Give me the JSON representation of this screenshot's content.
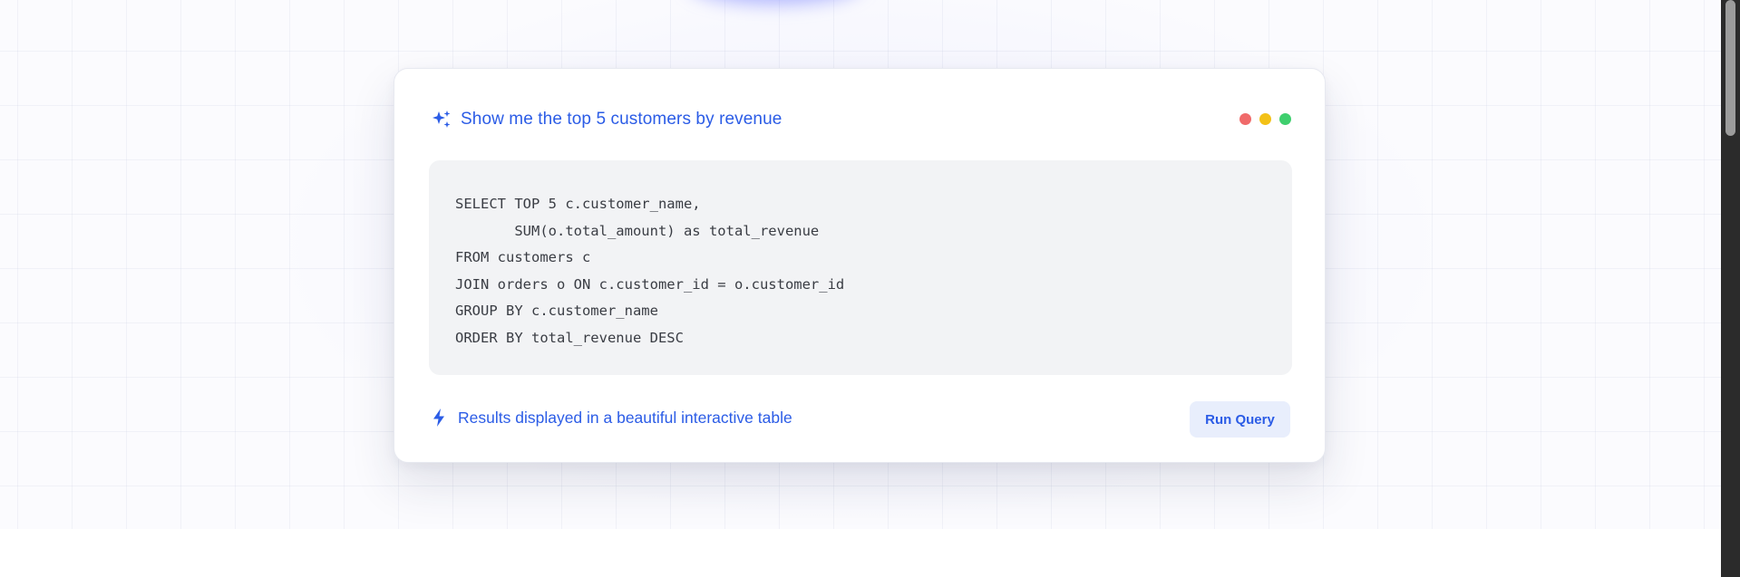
{
  "query_card": {
    "title": "Show me the top 5 customers by revenue",
    "icon": "sparkle-icon",
    "window_dots": [
      "#f06a6a",
      "#f3c117",
      "#3fcf6e"
    ],
    "code_lines": [
      "SELECT TOP 5 c.customer_name,",
      "       SUM(o.total_amount) as total_revenue",
      "FROM customers c",
      "JOIN orders o ON c.customer_id = o.customer_id",
      "GROUP BY c.customer_name",
      "ORDER BY total_revenue DESC"
    ],
    "footer_icon": "lightning-bolt-icon",
    "footer_text": "Results displayed in a beautiful interactive table",
    "run_button_label": "Run Query"
  },
  "colors": {
    "accent": "#2b5ce6",
    "code_background": "#f2f3f5",
    "button_background": "#e8eefc"
  }
}
